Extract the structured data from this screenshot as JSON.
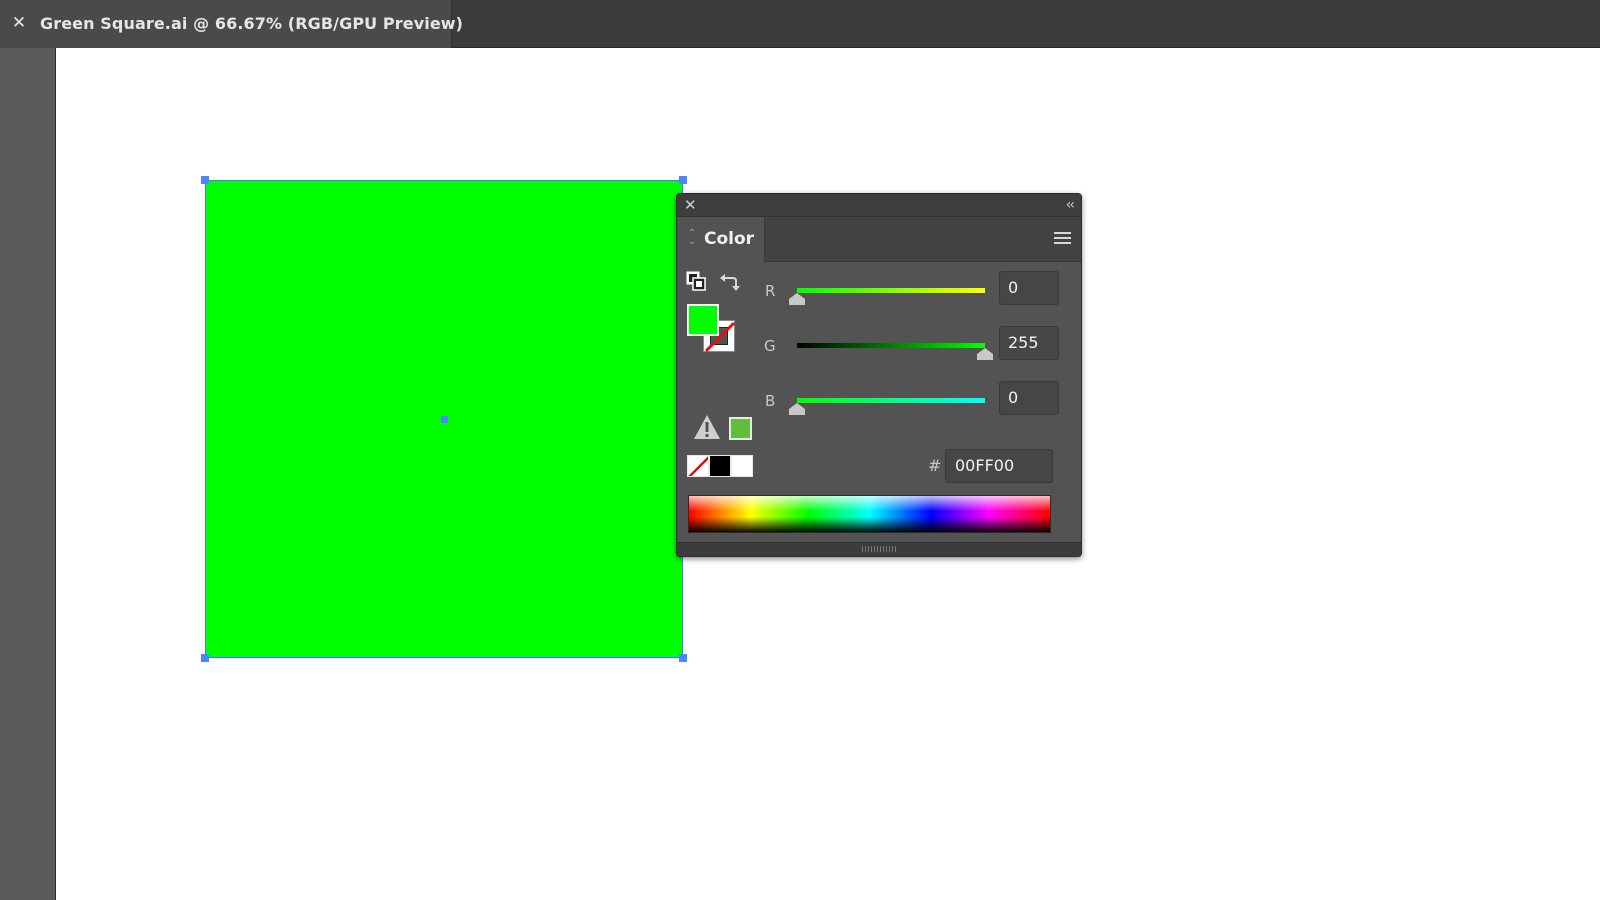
{
  "document_tab": {
    "close_icon": "close-icon",
    "title": "Green Square.ai @ 66.67% (RGB/GPU Preview)"
  },
  "canvas": {
    "artboard_color": "#FFFFFF",
    "shape": {
      "fill": "#00FF00",
      "selection_color": "#3C7CFF"
    }
  },
  "color_panel": {
    "tab_label": "Color",
    "fill_color": "#00FF00",
    "stroke": "none",
    "sliders": [
      {
        "label": "R",
        "value": "0",
        "level": 0
      },
      {
        "label": "G",
        "value": "255",
        "level": 1
      },
      {
        "label": "B",
        "value": "0",
        "level": 0
      }
    ],
    "hex_prefix": "#",
    "hex_value": "00FF00",
    "gamut_swatch_color": "#5FBE3C",
    "quick_swatches": [
      "none",
      "black",
      "white"
    ]
  }
}
